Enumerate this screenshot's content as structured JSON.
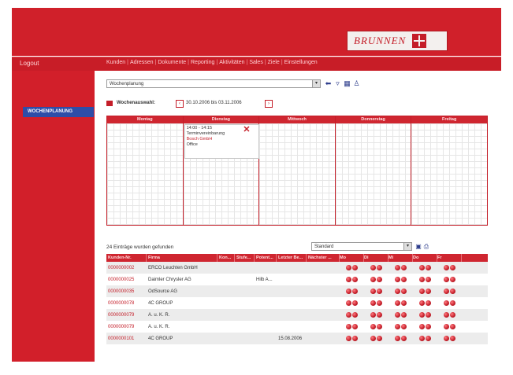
{
  "header": {
    "logo_text": "BRUNNEN"
  },
  "nav": {
    "logout": "Logout",
    "menu": [
      "Kunden",
      "Adressen",
      "Dokumente",
      "Reporting",
      "Aktivitäten",
      "Sales",
      "Ziele",
      "Einstellungen"
    ]
  },
  "sidebar": {
    "active_item": "WOCHENPLANUNG"
  },
  "toolbar": {
    "view_select": "Wochenplanung"
  },
  "week": {
    "label": "Wochenauswahl:",
    "range": "30.10.2006 bis 03.11.2006"
  },
  "calendar": {
    "days": [
      "Montag",
      "Dienstag",
      "Mittwoch",
      "Donnerstag",
      "Freitag"
    ],
    "appointment": {
      "time": "14:00 - 14:15",
      "title": "Terminvereinbarung",
      "company": "Bosch GmbH",
      "location": "Office"
    }
  },
  "list": {
    "count_text": "24 Einträge wurden gefunden",
    "view_select": "Standard",
    "headers": [
      "Kunden-Nr.",
      "Firma",
      "Kon...",
      "Stufe...",
      "Potent...",
      "Letzter Be...",
      "Nächster ...",
      "Mo",
      "Di",
      "Mi",
      "Do",
      "Fr"
    ],
    "rows": [
      {
        "nr": "0000000002",
        "firma": "ERCO Leuchten GmbH",
        "kon": "",
        "stufe": "",
        "pot": "",
        "letzter": "",
        "naechster": ""
      },
      {
        "nr": "0000000025",
        "firma": "Daimler Chrysler AG",
        "kon": "",
        "stufe": "",
        "pot": "Hilb A...",
        "letzter": "",
        "naechster": ""
      },
      {
        "nr": "0000000035",
        "firma": "OdSource AG",
        "kon": "",
        "stufe": "",
        "pot": "",
        "letzter": "",
        "naechster": ""
      },
      {
        "nr": "0000000078",
        "firma": "4C GROUP",
        "kon": "",
        "stufe": "",
        "pot": "",
        "letzter": "",
        "naechster": ""
      },
      {
        "nr": "0000000079",
        "firma": "A. u. K. R.",
        "kon": "",
        "stufe": "",
        "pot": "",
        "letzter": "",
        "naechster": ""
      },
      {
        "nr": "0000000079",
        "firma": "A. u. K. R.",
        "kon": "",
        "stufe": "",
        "pot": "",
        "letzter": "",
        "naechster": ""
      },
      {
        "nr": "0000000101",
        "firma": "4C GROUP",
        "kon": "",
        "stufe": "",
        "pot": "",
        "letzter": "15.08.2006",
        "naechster": ""
      }
    ]
  },
  "colors": {
    "brand_red": "#d0202a",
    "accent_blue": "#2e4da8"
  }
}
